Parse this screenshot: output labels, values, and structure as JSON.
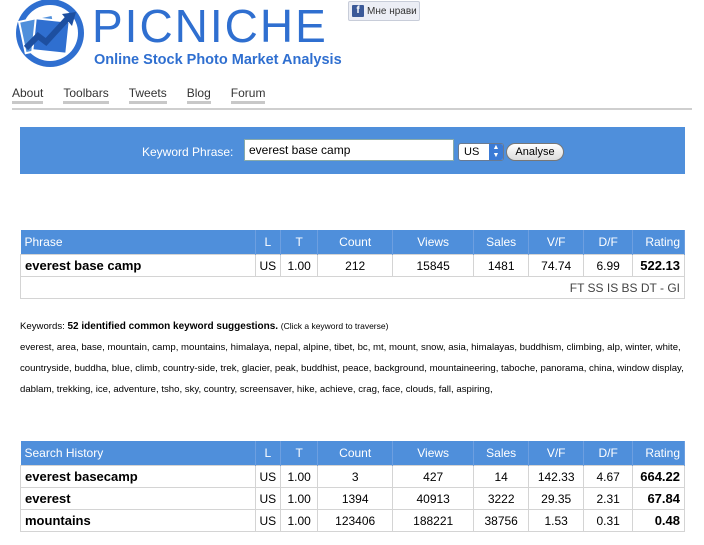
{
  "brand": {
    "name": "PICNICHE",
    "tagline": "Online Stock Photo Market Analysis"
  },
  "facebook": {
    "like_label": "Мне нрави"
  },
  "nav": [
    "About",
    "Toolbars",
    "Tweets",
    "Blog",
    "Forum"
  ],
  "search": {
    "label": "Keyword Phrase:",
    "value": "everest base camp",
    "country": "US",
    "button": "Analyse"
  },
  "phrase_table": {
    "headers": [
      "Phrase",
      "L",
      "T",
      "Count",
      "Views",
      "Sales",
      "V/F",
      "D/F",
      "Rating"
    ],
    "row": [
      "everest base camp",
      "US",
      "1.00",
      "212",
      "15845",
      "1481",
      "74.74",
      "6.99",
      "522.13"
    ],
    "sources": "FT SS IS BS DT - GI"
  },
  "keywords": {
    "prefix": "Keywords:",
    "summary": "52 identified common keyword suggestions.",
    "hint": "(Click a keyword to traverse)",
    "list": "everest, area, base, mountain, camp, mountains, himalaya, nepal, alpine, tibet, bc, mt, mount, snow, asia, himalayas, buddhism, climbing, alp, winter, white, countryside, buddha, blue, climb, country-side, trek, glacier, peak, buddhist, peace, background, mountaineering, taboche, panorama, china, window display, dablam, trekking, ice, adventure, tsho, sky, country, screensaver, hike, achieve, crag, face, clouds, fall, aspiring,"
  },
  "history": {
    "headers": [
      "Search History",
      "L",
      "T",
      "Count",
      "Views",
      "Sales",
      "V/F",
      "D/F",
      "Rating"
    ],
    "rows": [
      [
        "everest basecamp",
        "US",
        "1.00",
        "3",
        "427",
        "14",
        "142.33",
        "4.67",
        "664.22"
      ],
      [
        "everest",
        "US",
        "1.00",
        "1394",
        "40913",
        "3222",
        "29.35",
        "2.31",
        "67.84"
      ],
      [
        "mountains",
        "US",
        "1.00",
        "123406",
        "188221",
        "38756",
        "1.53",
        "0.31",
        "0.48"
      ]
    ]
  },
  "colors": {
    "accent": "#4f8fdb",
    "logo_blue": "#2f6fd0"
  }
}
